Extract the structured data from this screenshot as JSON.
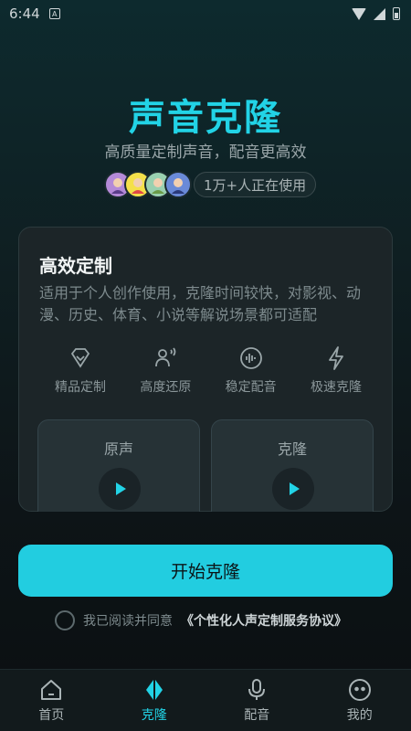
{
  "status_bar": {
    "time": "6:44",
    "app_icon": "A"
  },
  "hero": {
    "title": "声音克隆",
    "subtitle": "高质量定制声音，配音更高效",
    "users_text": "1万+人正在使用"
  },
  "card": {
    "title": "高效定制",
    "description": "适用于个人创作使用，克隆时间较快，对影视、动漫、历史、体育、小说等解说场景都可适配",
    "features": [
      {
        "label": "精品定制",
        "icon": "diamond-icon"
      },
      {
        "label": "高度还原",
        "icon": "voice-user-icon"
      },
      {
        "label": "稳定配音",
        "icon": "waveform-icon"
      },
      {
        "label": "极速克隆",
        "icon": "lightning-icon"
      }
    ],
    "samples": {
      "original": "原声",
      "cloned": "克隆"
    }
  },
  "start_button": "开始克隆",
  "agreement": {
    "prefix": "我已阅读并同意",
    "link": "《个性化人声定制服务协议》"
  },
  "nav": [
    {
      "label": "首页",
      "icon": "home-icon"
    },
    {
      "label": "克隆",
      "icon": "clone-icon"
    },
    {
      "label": "配音",
      "icon": "microphone-icon"
    },
    {
      "label": "我的",
      "icon": "profile-icon"
    }
  ],
  "colors": {
    "accent": "#22d3e6",
    "button": "#22cde0",
    "card_bg": "#1c2528"
  }
}
